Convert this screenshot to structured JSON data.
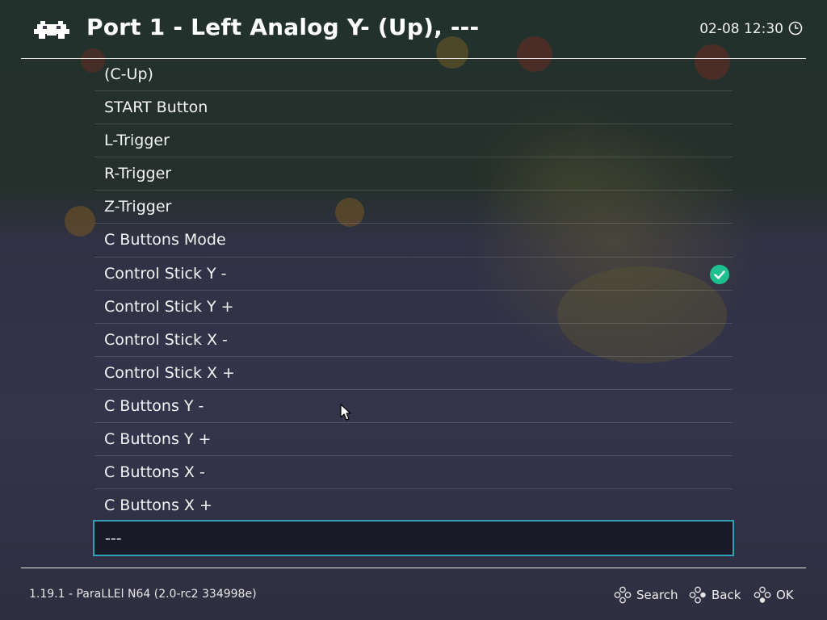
{
  "header": {
    "title": "Port 1 - Left Analog Y- (Up), ---",
    "clock": "02-08 12:30"
  },
  "menu": {
    "items": [
      {
        "label": "(C-Up)",
        "checked": false
      },
      {
        "label": "START Button",
        "checked": false
      },
      {
        "label": "L-Trigger",
        "checked": false
      },
      {
        "label": "R-Trigger",
        "checked": false
      },
      {
        "label": "Z-Trigger",
        "checked": false
      },
      {
        "label": "C Buttons Mode",
        "checked": false
      },
      {
        "label": "Control Stick Y -",
        "checked": true
      },
      {
        "label": "Control Stick Y +",
        "checked": false
      },
      {
        "label": "Control Stick X -",
        "checked": false
      },
      {
        "label": "Control Stick X +",
        "checked": false
      },
      {
        "label": "C Buttons Y -",
        "checked": false
      },
      {
        "label": "C Buttons Y +",
        "checked": false
      },
      {
        "label": "C Buttons X -",
        "checked": false
      },
      {
        "label": "C Buttons X +",
        "checked": false
      }
    ],
    "selected_item": "---"
  },
  "footer": {
    "version": "1.19.1 - ParaLLEl N64 (2.0-rc2 334998e)",
    "hints": [
      {
        "label": "Search",
        "icon": "gamepad-buttons-icon"
      },
      {
        "label": "Back",
        "icon": "gamepad-buttons-icon"
      },
      {
        "label": "OK",
        "icon": "gamepad-buttons-icon"
      }
    ]
  },
  "colors": {
    "accent": "#2fa3b6",
    "check": "#1fbf8f"
  }
}
